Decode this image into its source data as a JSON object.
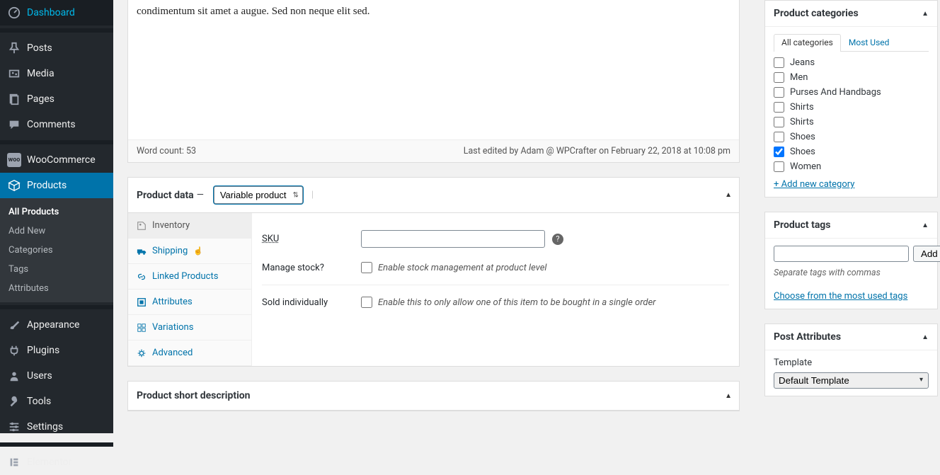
{
  "sidebar": {
    "items": [
      {
        "label": "Dashboard"
      },
      {
        "label": "Posts"
      },
      {
        "label": "Media"
      },
      {
        "label": "Pages"
      },
      {
        "label": "Comments"
      },
      {
        "label": "WooCommerce"
      },
      {
        "label": "Products"
      },
      {
        "label": "Appearance"
      },
      {
        "label": "Plugins"
      },
      {
        "label": "Users"
      },
      {
        "label": "Tools"
      },
      {
        "label": "Settings"
      },
      {
        "label": "Elementor"
      }
    ],
    "submenu": [
      {
        "label": "All Products"
      },
      {
        "label": "Add New"
      },
      {
        "label": "Categories"
      },
      {
        "label": "Tags"
      },
      {
        "label": "Attributes"
      }
    ]
  },
  "editor": {
    "content_preview": "condimentum sit amet a augue. Sed non neque elit sed.",
    "word_count_label": "Word count: 53",
    "last_edited": "Last edited by Adam @ WPCrafter on February 22, 2018 at 10:08 pm"
  },
  "product_data": {
    "title": "Product data",
    "type_selected": "Variable product",
    "tabs": [
      {
        "label": "Inventory"
      },
      {
        "label": "Shipping"
      },
      {
        "label": "Linked Products"
      },
      {
        "label": "Attributes"
      },
      {
        "label": "Variations"
      },
      {
        "label": "Advanced"
      }
    ],
    "sku_label": "SKU",
    "manage_stock_label": "Manage stock?",
    "manage_stock_desc": "Enable stock management at product level",
    "sold_individually_label": "Sold individually",
    "sold_individually_desc": "Enable this to only allow one of this item to be bought in a single order"
  },
  "short_desc_title": "Product short description",
  "right": {
    "categories": {
      "title": "Product categories",
      "tabs": {
        "all": "All categories",
        "most": "Most Used"
      },
      "items": [
        {
          "label": "Jeans",
          "checked": false
        },
        {
          "label": "Men",
          "checked": false
        },
        {
          "label": "Purses And Handbags",
          "checked": false
        },
        {
          "label": "Shirts",
          "checked": false
        },
        {
          "label": "Shirts",
          "checked": false
        },
        {
          "label": "Shoes",
          "checked": false
        },
        {
          "label": "Shoes",
          "checked": true
        },
        {
          "label": "Women",
          "checked": false
        }
      ],
      "add_new": "+ Add new category"
    },
    "tags": {
      "title": "Product tags",
      "add_btn": "Add",
      "hint": "Separate tags with commas",
      "choose": "Choose from the most used tags"
    },
    "post_attr": {
      "title": "Post Attributes",
      "template_label": "Template",
      "template_value": "Default Template"
    }
  }
}
